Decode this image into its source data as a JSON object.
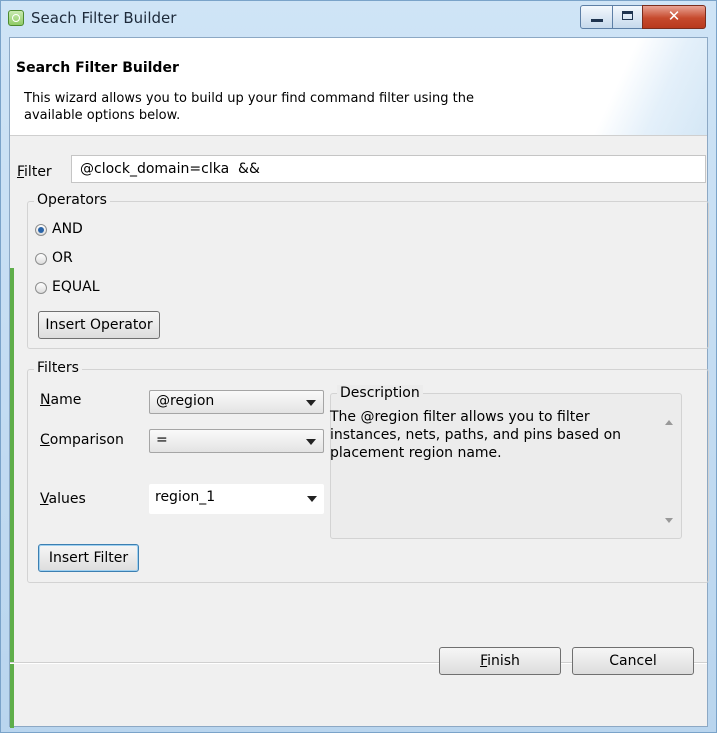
{
  "window": {
    "title": "Seach Filter Builder"
  },
  "banner": {
    "title": "Search Filter Builder",
    "description": "This wizard allows you to build up your find command filter using the available options below."
  },
  "filter": {
    "label": "Filter",
    "value": "@clock_domain=clka  &&"
  },
  "operators": {
    "title": "Operators",
    "options": [
      {
        "label": "AND",
        "selected": true
      },
      {
        "label": "OR",
        "selected": false
      },
      {
        "label": "EQUAL",
        "selected": false
      }
    ],
    "insert_label": "Insert Operator"
  },
  "filters": {
    "title": "Filters",
    "name_label": "Name",
    "name_value": "@region",
    "comparison_label": "Comparison",
    "comparison_value": "=",
    "values_label": "Values",
    "values_value": "region_1",
    "description_title": "Description",
    "description_text": "The @region filter allows you to filter instances, nets, paths, and pins based on placement region name.",
    "insert_label": "Insert Filter"
  },
  "footer": {
    "finish_label": "Finish",
    "cancel_label": "Cancel"
  },
  "colors": {
    "accent": "#2a64a8",
    "close_button": "#c64a2d",
    "titlebar": "#c3dcf1"
  }
}
